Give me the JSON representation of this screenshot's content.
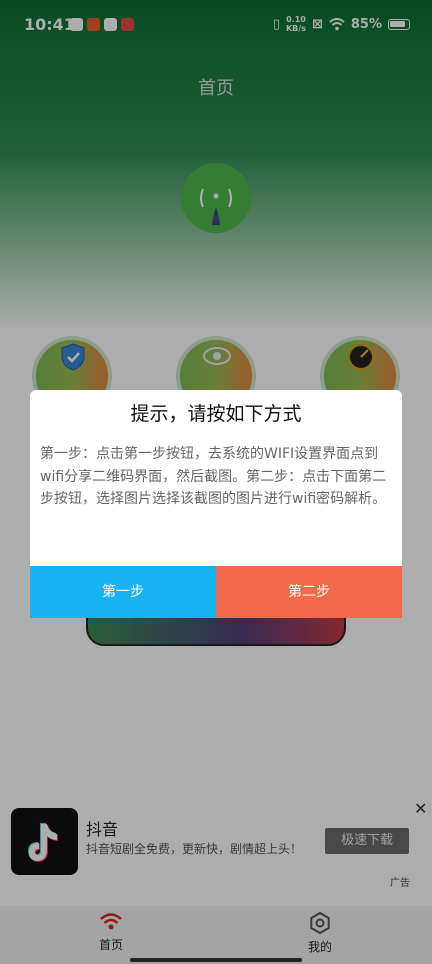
{
  "status_bar": {
    "time": "10:41",
    "net_speed_value": "0.10",
    "net_speed_unit": "KB/s",
    "battery": "85%"
  },
  "header": {
    "title": "首页"
  },
  "dialog": {
    "title": "提示，请按如下方式",
    "message": "第一步：点击第一步按钮，去系统的WIFI设置界面点到wifi分享二维码界面，然后截图。第二步：点击下面第二步按钮，选择图片选择该截图的图片进行wifi密码解析。",
    "first_button": "第一步",
    "second_button": "第二步",
    "first_color": "#1ab3f2",
    "second_color": "#f26a49"
  },
  "ad": {
    "title": "抖音",
    "description": "抖音短剧全免费，更新快，剧情超上头！",
    "button": "极速下载",
    "tag": "广告",
    "close": "✕"
  },
  "bottom_nav": {
    "items": [
      {
        "label": "首页",
        "icon": "wifi-icon",
        "active": true
      },
      {
        "label": "我的",
        "icon": "gear-icon",
        "active": false
      }
    ]
  },
  "colors": {
    "brand_green": "#0c6e35"
  }
}
